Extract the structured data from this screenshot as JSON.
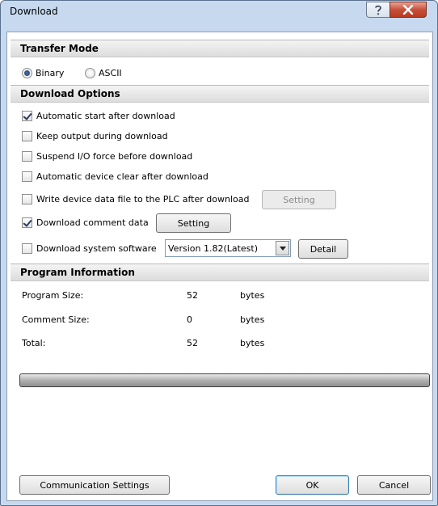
{
  "window": {
    "title": "Download"
  },
  "transfer_mode": {
    "header": "Transfer Mode",
    "options": [
      {
        "label": "Binary",
        "selected": true
      },
      {
        "label": "ASCII",
        "selected": false
      }
    ]
  },
  "download_options": {
    "header": "Download Options",
    "items": [
      {
        "label": "Automatic start after download",
        "checked": true
      },
      {
        "label": "Keep output during download",
        "checked": false
      },
      {
        "label": "Suspend I/O force before download",
        "checked": false
      },
      {
        "label": "Automatic device clear after download",
        "checked": false
      },
      {
        "label": "Write device data file to the PLC after download",
        "checked": false
      },
      {
        "label": "Download comment data",
        "checked": true
      },
      {
        "label": "Download system software",
        "checked": false
      }
    ],
    "write_setting_label": "Setting",
    "comment_setting_label": "Setting",
    "version_select": "Version 1.82(Latest)",
    "detail_label": "Detail"
  },
  "program_information": {
    "header": "Program Information",
    "rows": [
      {
        "label": "Program Size:",
        "value": "52",
        "unit": "bytes"
      },
      {
        "label": "Comment Size:",
        "value": "0",
        "unit": "bytes"
      },
      {
        "label": "Total:",
        "value": "52",
        "unit": "bytes"
      }
    ]
  },
  "progress": {
    "fraction": 0
  },
  "footer": {
    "communication_settings_label": "Communication Settings",
    "ok_label": "OK",
    "cancel_label": "Cancel"
  }
}
